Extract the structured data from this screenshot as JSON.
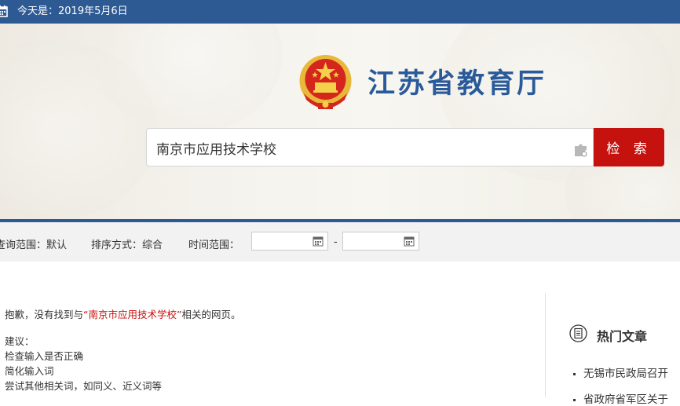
{
  "topbar": {
    "date_text": "今天是：2019年5月6日",
    "icon": "calendar-icon"
  },
  "header": {
    "emblem": "national-emblem",
    "title": "江苏省教育厅"
  },
  "search": {
    "value": "南京市应用技术学校",
    "button_label": "检 索",
    "plugin_icon": "puzzle-piece-icon"
  },
  "filters": {
    "scope_label": "查询范围：默认",
    "sort_label": "排序方式：综合",
    "time_label": "时间范围：",
    "date_from": "",
    "date_to": "",
    "separator": "-"
  },
  "result": {
    "prefix": "抱歉，没有找到与",
    "keyword": "“南京市应用技术学校”",
    "suffix": "相关的网页。",
    "suggestions_title": "建议：",
    "suggestions": [
      "检查输入是否正确",
      "简化输入词",
      "尝试其他相关词，如同义、近义词等"
    ]
  },
  "sidebar": {
    "hot_title": "热门文章",
    "items": [
      "无锡市民政局召开",
      "省政府省军区关于"
    ]
  },
  "colors": {
    "brand_blue": "#2e5a94",
    "search_red": "#c6120f",
    "keyword_red": "#c6120f"
  }
}
